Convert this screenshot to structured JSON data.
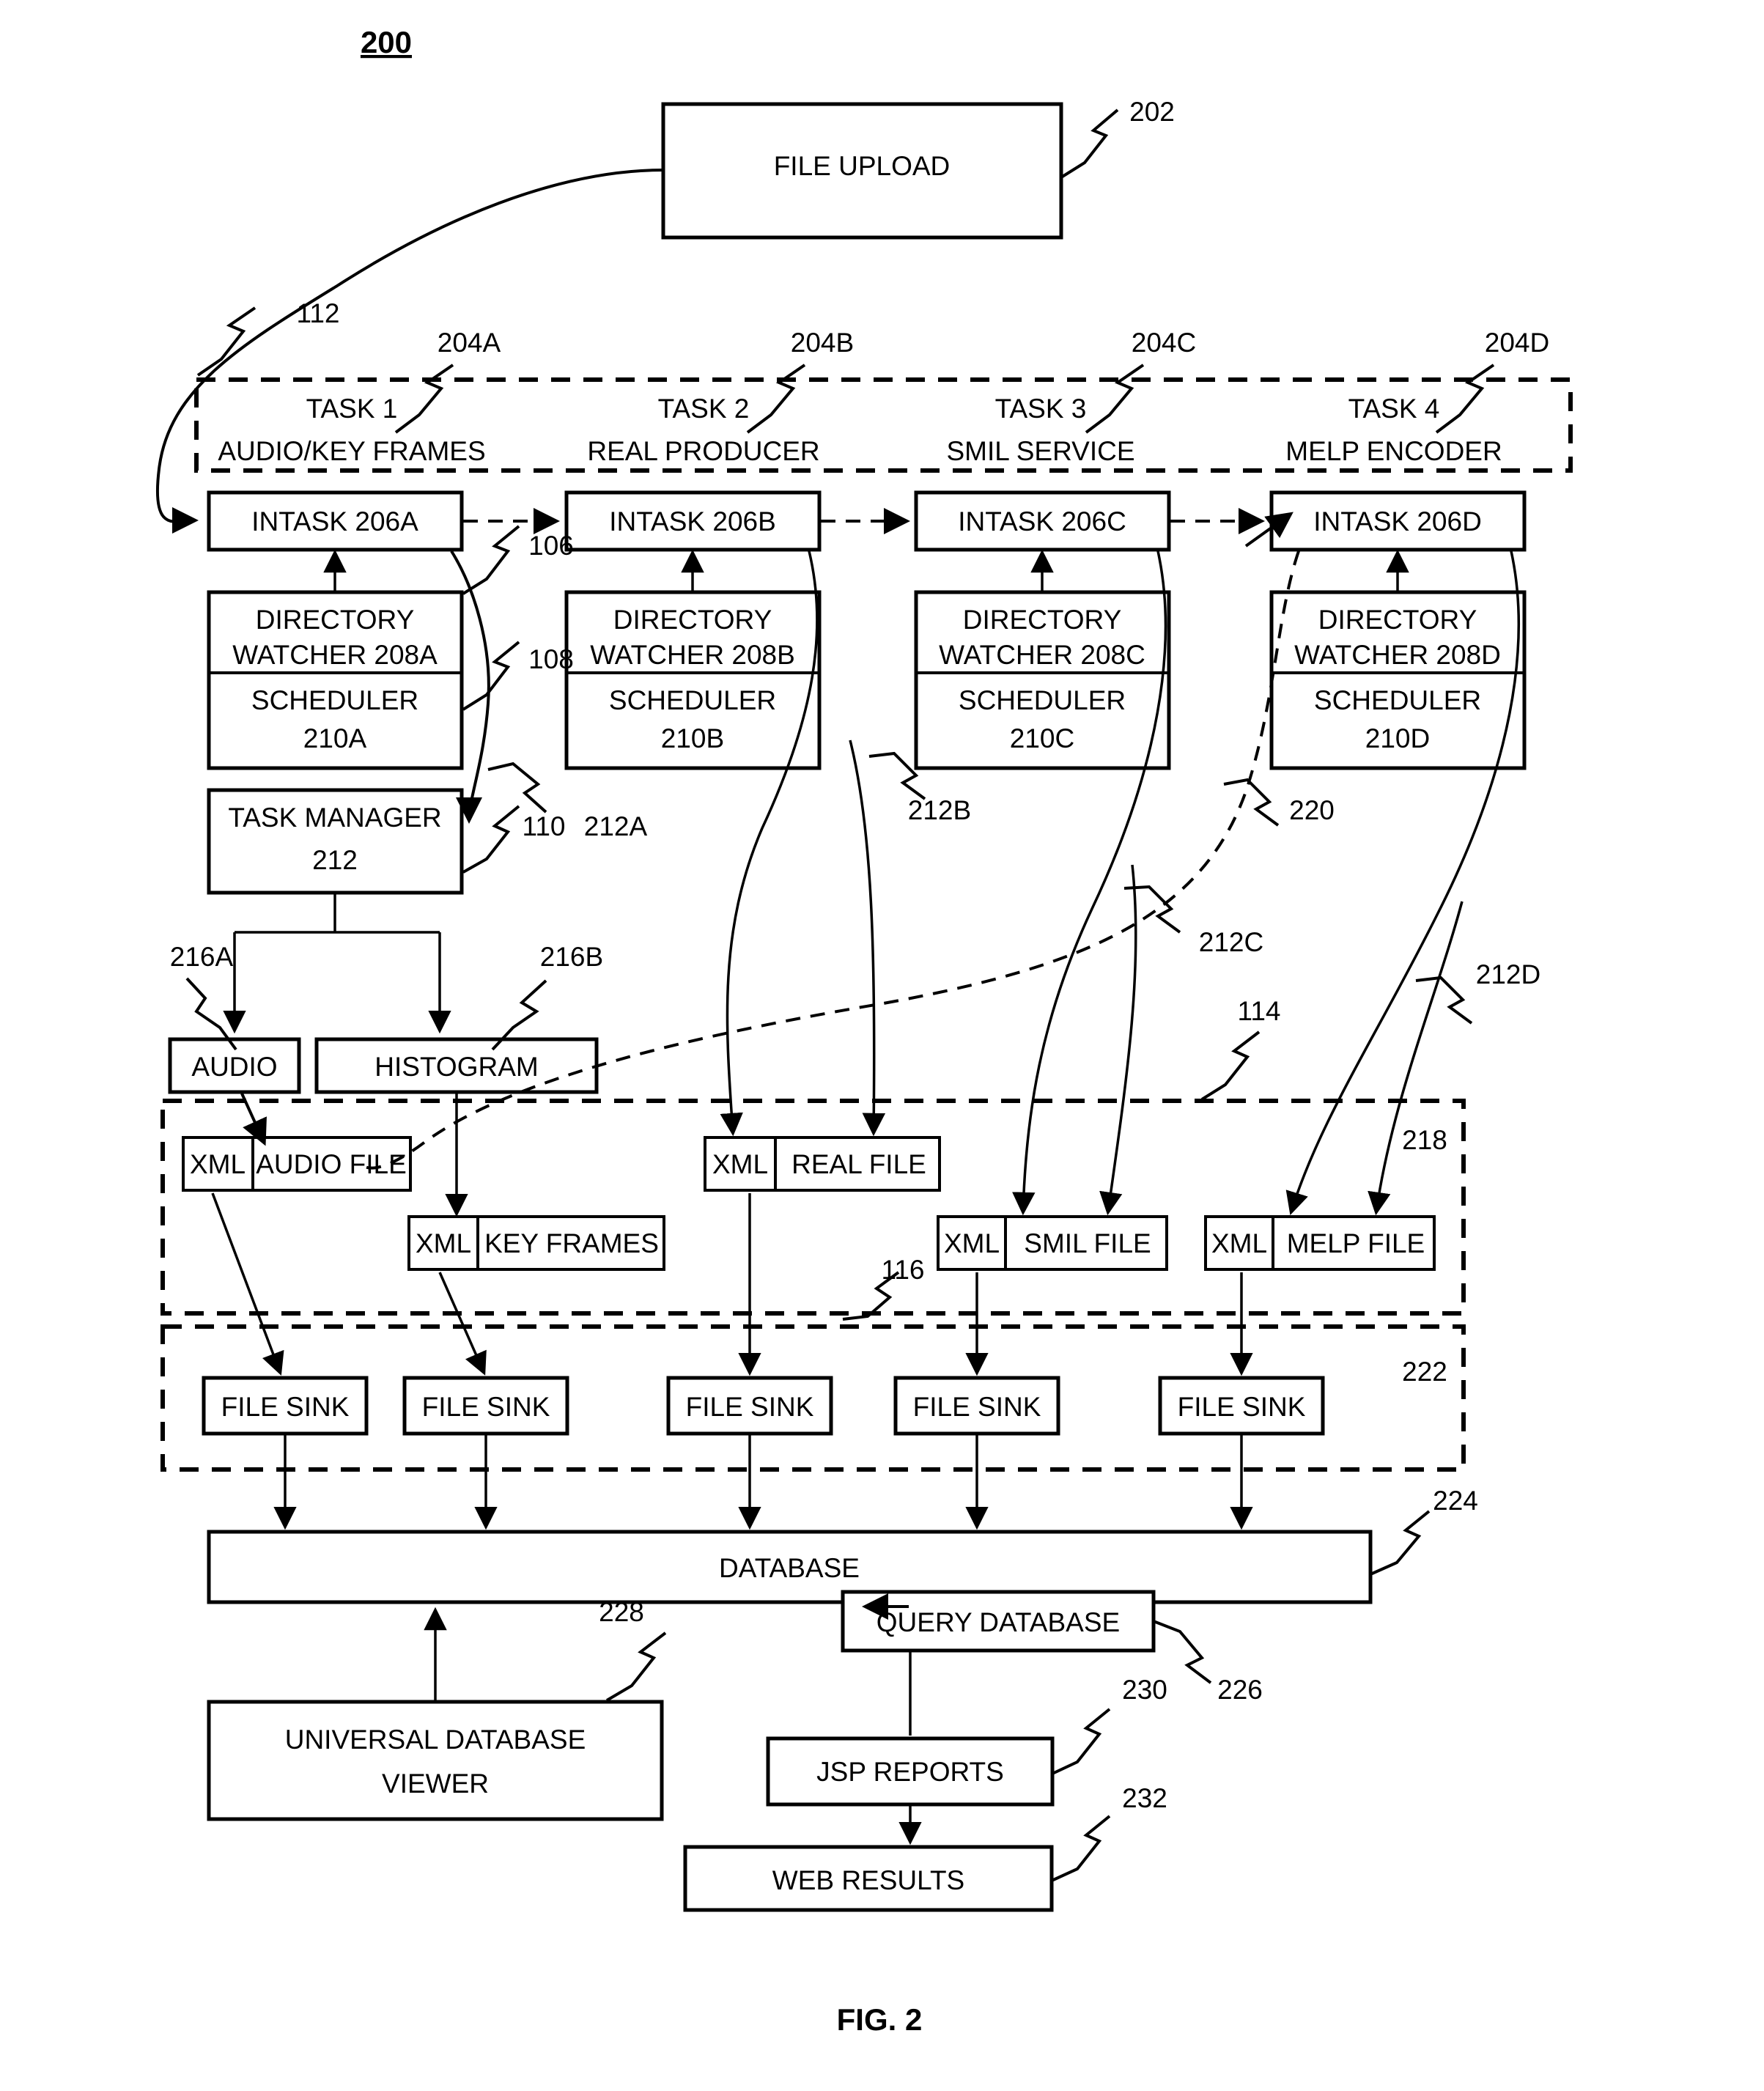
{
  "figure": {
    "number_label": "200",
    "caption": "FIG. 2"
  },
  "nodes": {
    "file_upload": {
      "label": "FILE UPLOAD",
      "ref": "202"
    },
    "tasks_group_ref": "112",
    "tasks": [
      {
        "title": "TASK 1",
        "subtitle": "AUDIO/KEY FRAMES",
        "ref": "204A",
        "intask": "INTASK 206A",
        "watcher_l1": "DIRECTORY",
        "watcher_l2": "WATCHER 208A",
        "sched_l1": "SCHEDULER",
        "sched_l2": "210A"
      },
      {
        "title": "TASK 2",
        "subtitle": "REAL PRODUCER",
        "ref": "204B",
        "intask": "INTASK 206B",
        "watcher_l1": "DIRECTORY",
        "watcher_l2": "WATCHER 208B",
        "sched_l1": "SCHEDULER",
        "sched_l2": "210B"
      },
      {
        "title": "TASK 3",
        "subtitle": "SMIL SERVICE",
        "ref": "204C",
        "intask": "INTASK 206C",
        "watcher_l1": "DIRECTORY",
        "watcher_l2": "WATCHER 208C",
        "sched_l1": "SCHEDULER",
        "sched_l2": "210C"
      },
      {
        "title": "TASK 4",
        "subtitle": "MELP ENCODER",
        "ref": "204D",
        "intask": "INTASK 206D",
        "watcher_l1": "DIRECTORY",
        "watcher_l2": "WATCHER 208D",
        "sched_l1": "SCHEDULER",
        "sched_l2": "210D"
      }
    ],
    "task_manager": {
      "line1": "TASK MANAGER",
      "line2": "212"
    },
    "audio": {
      "label": "AUDIO",
      "ref": "216A"
    },
    "histogram": {
      "label": "HISTOGRAM",
      "ref": "216B"
    },
    "xml_files_group_ref": "218",
    "xml_files": [
      {
        "tag": "XML",
        "label": "AUDIO FILE"
      },
      {
        "tag": "XML",
        "label": "KEY FRAMES"
      },
      {
        "tag": "XML",
        "label": "REAL FILE"
      },
      {
        "tag": "XML",
        "label": "SMIL FILE"
      },
      {
        "tag": "XML",
        "label": "MELP FILE"
      }
    ],
    "file_sinks_group_ref": "222",
    "file_sinks": [
      {
        "label": "FILE SINK"
      },
      {
        "label": "FILE SINK"
      },
      {
        "label": "FILE SINK"
      },
      {
        "label": "FILE SINK"
      },
      {
        "label": "FILE SINK"
      }
    ],
    "database": {
      "label": "DATABASE",
      "ref": "224"
    },
    "query_database": {
      "label": "QUERY DATABASE",
      "ref": "226"
    },
    "universal_viewer": {
      "line1": "UNIVERSAL DATABASE",
      "line2": "VIEWER",
      "ref": "228"
    },
    "jsp_reports": {
      "label": "JSP REPORTS",
      "ref": "230"
    },
    "web_results": {
      "label": "WEB RESULTS",
      "ref": "232"
    }
  },
  "reference_numerals": {
    "n106": "106",
    "n108": "108",
    "n110": "110",
    "n112": "112",
    "n114": "114",
    "n116": "116",
    "n212A": "212A",
    "n212B": "212B",
    "n212C": "212C",
    "n212D": "212D",
    "n218": "218",
    "n220": "220",
    "n222": "222",
    "n224": "224",
    "n226": "226",
    "n228": "228",
    "n230": "230",
    "n232": "232"
  }
}
